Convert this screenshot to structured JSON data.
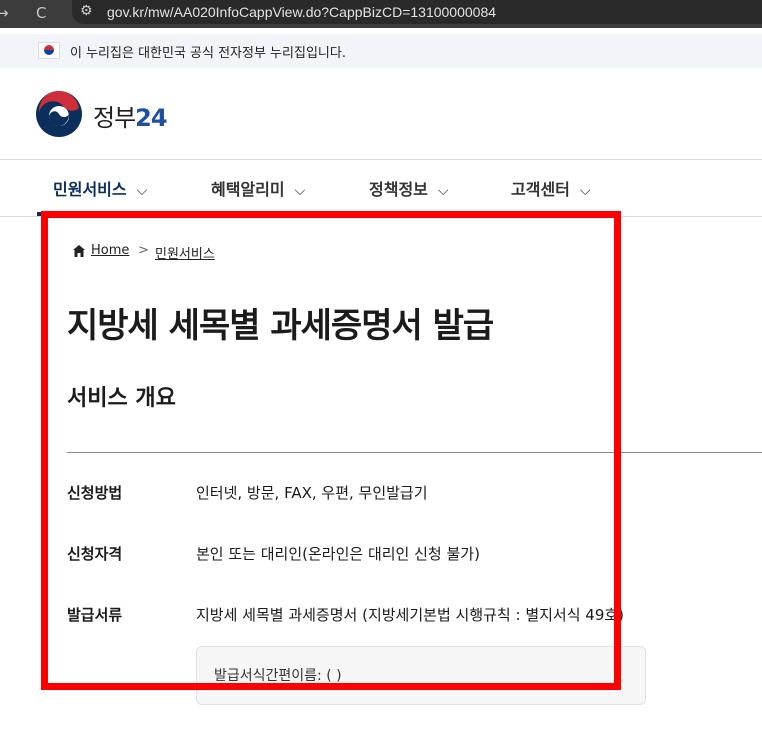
{
  "browser": {
    "back_icon": "→",
    "reload_icon": "C",
    "site_info_icon": "⚙",
    "url": "gov.kr/mw/AA020InfoCappView.do?CappBizCD=13100000084"
  },
  "gov_banner": {
    "text": "이 누리집은 대한민국 공식 전자정부 누리집입니다."
  },
  "logo": {
    "text_main": "정부",
    "text_num": "24"
  },
  "menu": {
    "items": [
      {
        "label": "민원서비스",
        "chevron": "⌵"
      },
      {
        "label": "혜택알리미",
        "chevron": "⌵"
      },
      {
        "label": "정책정보",
        "chevron": "⌵"
      },
      {
        "label": "고객센터",
        "chevron": "⌵"
      }
    ],
    "active_color": "#0b2e5b"
  },
  "breadcrumb": {
    "home": "Home",
    "separator": ">",
    "current": "민원서비스"
  },
  "page": {
    "title": "지방세 세목별 과세증명서 발급",
    "section_title": "서비스 개요"
  },
  "info": {
    "rows": [
      {
        "label": "신청방법",
        "value": "인터넷, 방문, FAX, 우편, 무인발급기"
      },
      {
        "label": "신청자격",
        "value": "본인 또는 대리인(온라인은 대리인 신청 불가)"
      },
      {
        "label": "발급서류",
        "value": "지방세 세목별 과세증명서 (지방세기본법 시행규칙 : 별지서식 49호)"
      }
    ],
    "form_box_text": "발급서식간편이름: ( )"
  },
  "colors": {
    "highlight": "#ff0000",
    "browser_bar": "#3c3c3c",
    "banner_bg": "#f1f4f8"
  }
}
